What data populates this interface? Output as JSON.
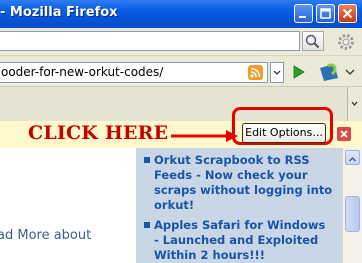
{
  "window": {
    "title": "- Mozilla Firefox"
  },
  "address_bar": {
    "url": "ooder-for-new-orkut-codes/"
  },
  "annotation": {
    "label": "CLICK HERE",
    "color": "#c40000"
  },
  "notification_bar": {
    "button_label": "Edit Options..."
  },
  "page": {
    "left_link": "ad More about",
    "side_items": [
      {
        "text": "Orkut Scrapbook to RSS\nFeeds - Now check your\nscraps without logging into\norkut!"
      },
      {
        "text": "Apples Safari for Windows\n- Launched and Exploited\nWithin 2 hours!!!"
      }
    ]
  }
}
